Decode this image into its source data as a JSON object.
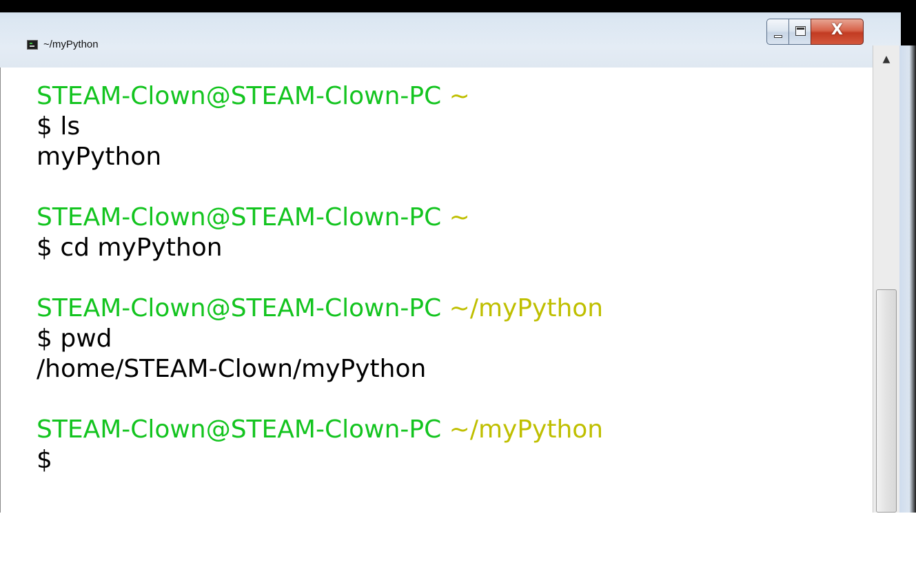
{
  "window": {
    "title": "~/myPython",
    "controls": {
      "minimize_icon": "minimize-icon",
      "maximize_icon": "maximize-icon",
      "close_label": "X"
    }
  },
  "terminal": {
    "colors": {
      "prompt_user": "#13c41f",
      "prompt_path": "#bfbf00",
      "text": "#000000"
    },
    "lines": [
      {
        "user": "STEAM-Clown@STEAM-Clown-PC",
        "path": "~"
      },
      {
        "text": "$ ls"
      },
      {
        "text": "myPython"
      },
      {
        "text": ""
      },
      {
        "user": "STEAM-Clown@STEAM-Clown-PC",
        "path": "~"
      },
      {
        "text": "$ cd myPython"
      },
      {
        "text": ""
      },
      {
        "user": "STEAM-Clown@STEAM-Clown-PC",
        "path": "~/myPython"
      },
      {
        "text": "$ pwd"
      },
      {
        "text": "/home/STEAM-Clown/myPython"
      },
      {
        "text": ""
      },
      {
        "user": "STEAM-Clown@STEAM-Clown-PC",
        "path": "~/myPython"
      },
      {
        "text": "$"
      }
    ]
  },
  "scrollbar": {
    "up_arrow": "▲"
  }
}
